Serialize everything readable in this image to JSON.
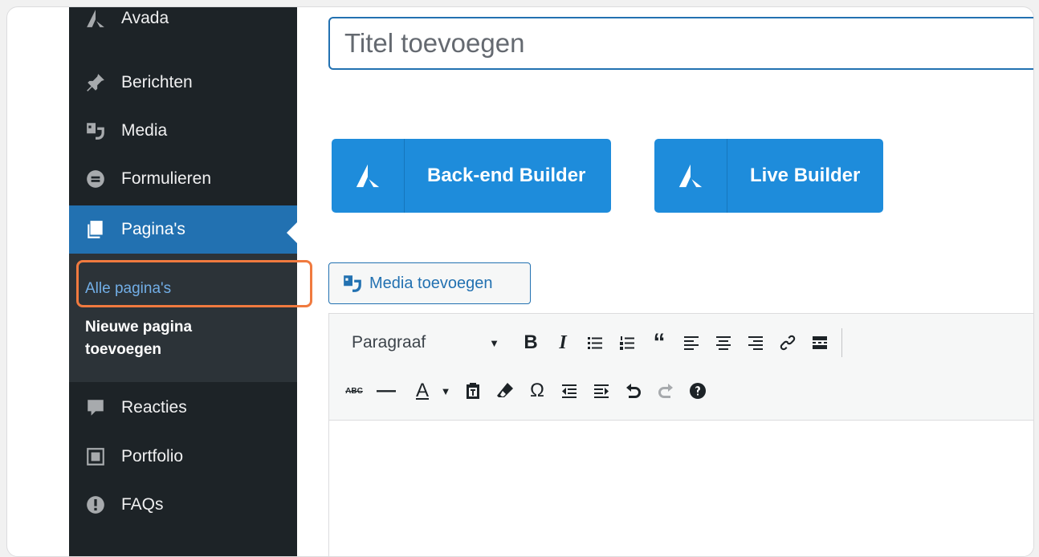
{
  "sidebar": {
    "items": [
      {
        "label": "Avada",
        "icon": "avada-icon"
      },
      {
        "label": "Berichten",
        "icon": "pin-icon"
      },
      {
        "label": "Media",
        "icon": "media-icon"
      },
      {
        "label": "Formulieren",
        "icon": "forms-icon"
      },
      {
        "label": "Pagina's",
        "icon": "pages-icon"
      },
      {
        "label": "Reacties",
        "icon": "comment-icon"
      },
      {
        "label": "Portfolio",
        "icon": "portfolio-icon"
      },
      {
        "label": "FAQs",
        "icon": "faq-icon"
      }
    ],
    "submenu": {
      "all_pages": "Alle pagina's",
      "new_page_line1": "Nieuwe pagina",
      "new_page_line2": "toevoegen"
    }
  },
  "editor": {
    "title_placeholder": "Titel toevoegen",
    "backend_builder": "Back-end Builder",
    "live_builder": "Live Builder",
    "add_media": "Media toevoegen",
    "format": "Paragraaf"
  },
  "colors": {
    "sidebar_bg": "#1d2327",
    "active": "#2271b1",
    "builder": "#1e8cdb",
    "highlight": "#f07a3f"
  }
}
